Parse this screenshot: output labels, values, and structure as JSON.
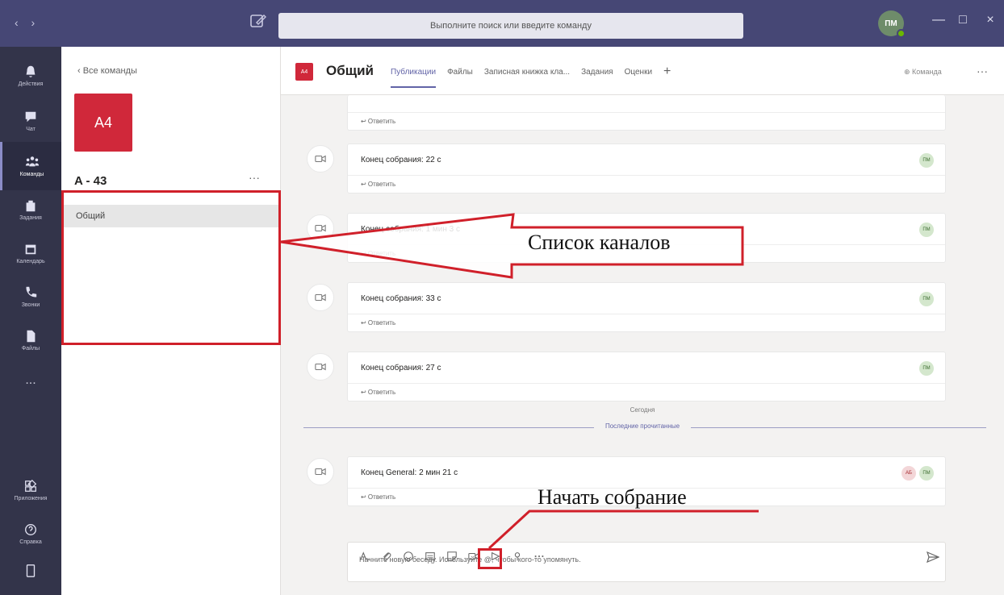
{
  "titlebar": {
    "nav": "‹ ›",
    "search_placeholder": "Выполните поиск или введите команду",
    "user_initials": "ПМ",
    "minimize": "—",
    "maximize": "□",
    "close": "×"
  },
  "rail": {
    "items": [
      {
        "label": "Действия",
        "icon": "bell-icon"
      },
      {
        "label": "Чат",
        "icon": "chat-icon"
      },
      {
        "label": "Команды",
        "icon": "teams-icon",
        "active": true
      },
      {
        "label": "Задания",
        "icon": "assignments-icon"
      },
      {
        "label": "Календарь",
        "icon": "calendar-icon"
      },
      {
        "label": "Звонки",
        "icon": "phone-icon"
      },
      {
        "label": "Файлы",
        "icon": "files-icon"
      },
      {
        "label": "...",
        "icon": "more-icon"
      }
    ],
    "bottom": [
      {
        "label": "Приложения",
        "icon": "apps-icon"
      },
      {
        "label": "Справка",
        "icon": "help-icon"
      },
      {
        "label": "",
        "icon": "device-icon"
      }
    ]
  },
  "team_panel": {
    "back": "‹ Все команды",
    "tile": "A4",
    "name": "A - 43",
    "more": "···",
    "channels": [
      "Общий"
    ]
  },
  "channel_header": {
    "tile": "A4",
    "name": "Общий",
    "tabs": [
      "Публикации",
      "Файлы",
      "Записная книжка кла...",
      "Задания",
      "Оценки"
    ],
    "add_tab": "+",
    "team_button": "⊕ Команда",
    "more": "···"
  },
  "posts": [
    {
      "title": "",
      "reply": "↩ Ответить",
      "avatars": []
    },
    {
      "title": "Конец собрания: 22 с",
      "reply": "↩ Ответить",
      "avatars": [
        "ПМ"
      ]
    },
    {
      "title": "Конец собрания: 1 мин 3 с",
      "reply": "↩ Ответить",
      "avatars": [
        "ПМ"
      ]
    },
    {
      "title": "Конец собрания: 33 с",
      "reply": "↩ Ответить",
      "avatars": [
        "ПМ"
      ]
    },
    {
      "title": "Конец собрания: 27 с",
      "reply": "↩ Ответить",
      "avatars": [
        "ПМ"
      ]
    },
    {
      "title": "Конец General: 2 мин 21 с",
      "reply": "↩ Ответить",
      "avatars": [
        "АБ",
        "ПМ"
      ]
    }
  ],
  "divider": {
    "day": "Сегодня",
    "last_read": "Последние прочитанные"
  },
  "compose": {
    "placeholder": "Начните новую беседу. Используйте @, чтобы кого-то упомянуть."
  },
  "annotations": {
    "channels_label": "Список каналов",
    "meet_label": "Начать собрание",
    "color": "#d0202a"
  },
  "colors": {
    "titlebar": "#464775",
    "rail": "#33344a",
    "accent": "#6264a7",
    "team_tile": "#d0283a"
  }
}
